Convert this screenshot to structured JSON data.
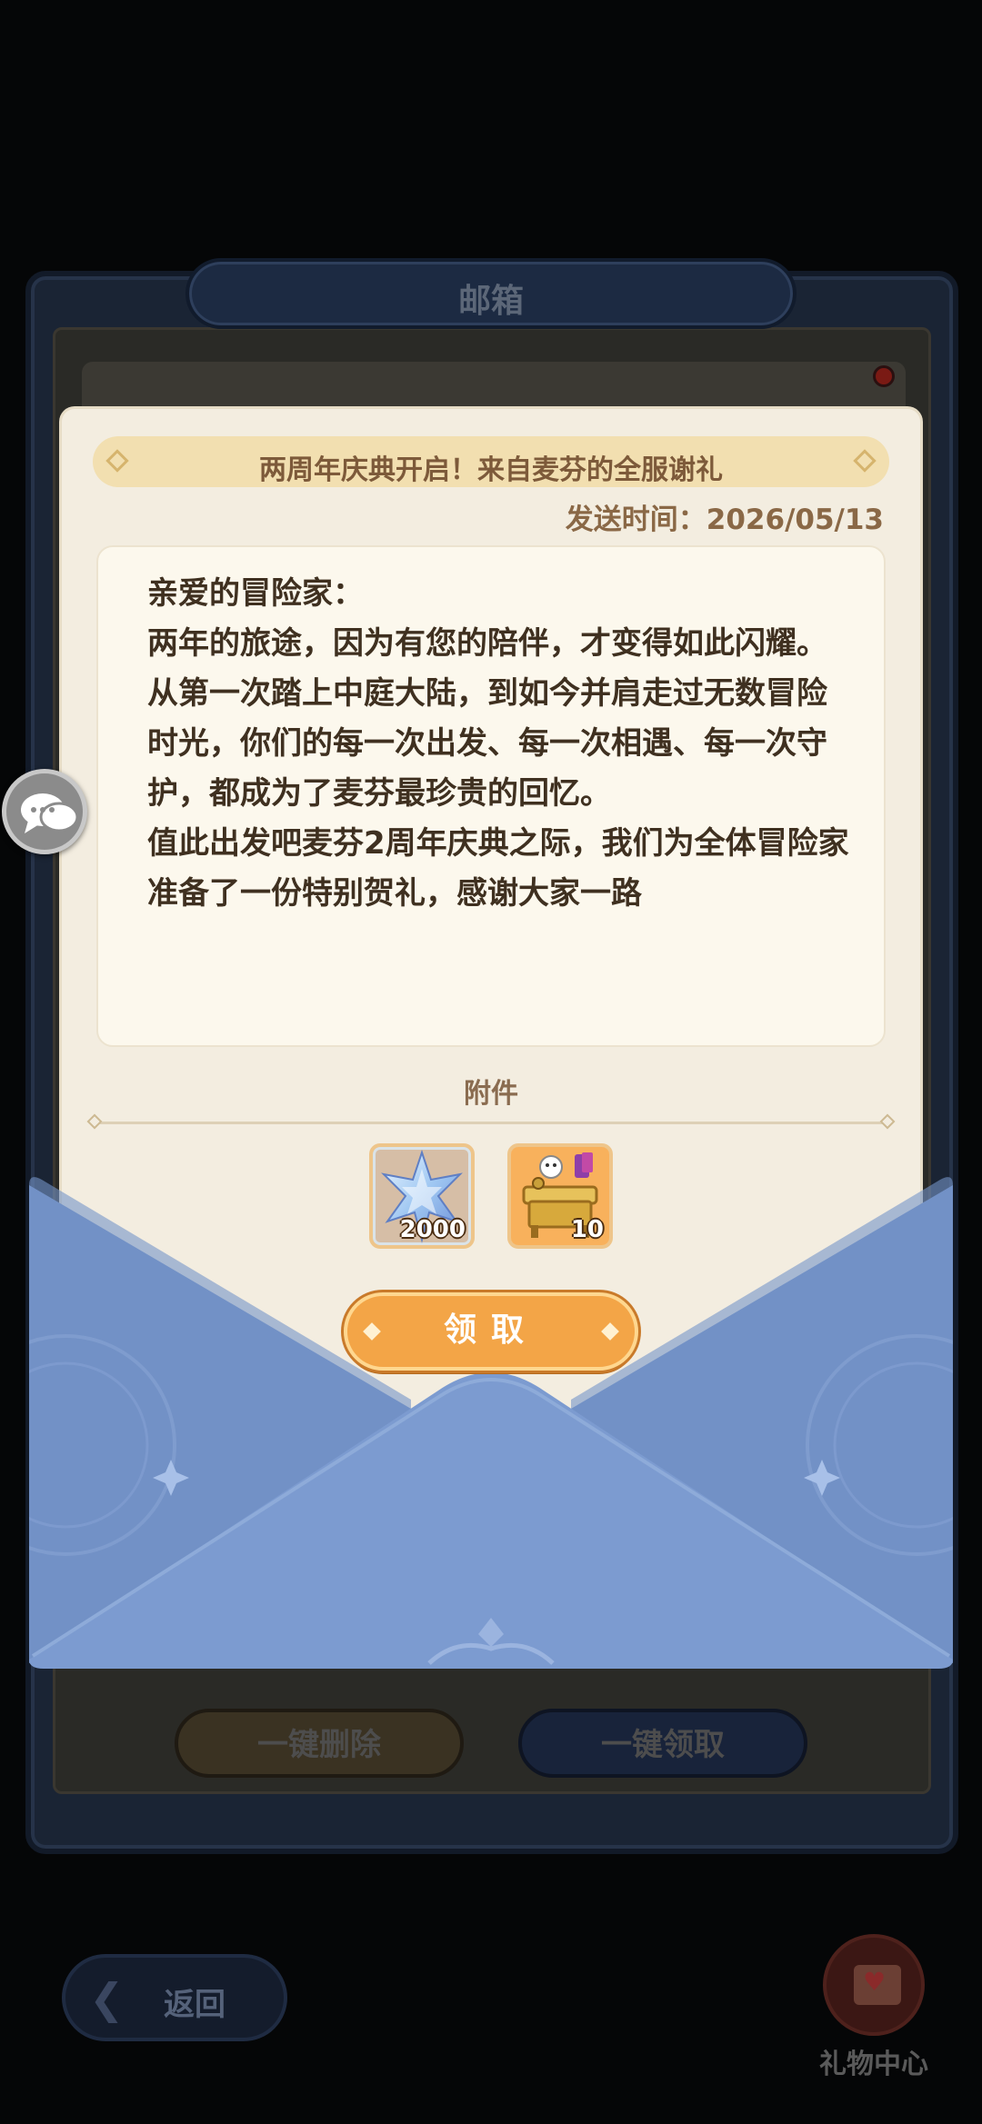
{
  "mailbox": {
    "title": "邮箱",
    "delete_all_label": "一键删除",
    "claim_all_label": "一键领取"
  },
  "nav": {
    "back_label": "返回",
    "gift_center_label": "礼物中心"
  },
  "letter": {
    "subject": "两周年庆典开启！来自麦芬的全服谢礼",
    "send_time_label": "发送时间：",
    "send_time_value": "2026/05/13",
    "body": [
      "亲爱的冒险家：",
      "两年的旅途，因为有您的陪伴，才变得如此闪耀。",
      "从第一次踏上中庭大陆，到如今并肩走过无数冒险时光，你们的每一次出发、每一次相遇、每一次守护，都成为了麦芬最珍贵的回忆。",
      "值此出发吧麦芬2周年庆典之际，我们为全体冒险家准备了一份特别贺礼，感谢大家一路"
    ],
    "attachments_label": "附件",
    "attachments": [
      {
        "icon": "star-crystal-icon",
        "quantity": "2000"
      },
      {
        "icon": "golden-desk-furniture-icon",
        "quantity": "10"
      }
    ],
    "claim_label": "领取"
  },
  "colors": {
    "envelope": "#7594c8",
    "claim_button": "#f3a547",
    "paper": "#f3ede0"
  }
}
